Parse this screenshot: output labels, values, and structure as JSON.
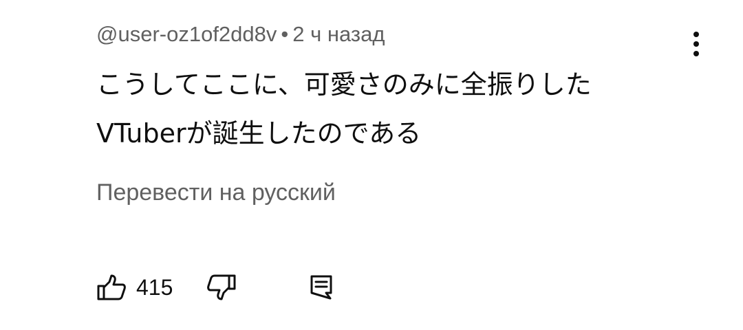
{
  "comment": {
    "author": "@user-oz1of2dd8v",
    "separator": "•",
    "time": "2 ч назад",
    "text": "こうしてここに、可愛さのみに全振りした\nVTuberが誕生したのである",
    "translate_label": "Перевести на русский",
    "like_count": "415",
    "icons": {
      "more": "more-vert-icon",
      "like": "thumb-up-icon",
      "dislike": "thumb-down-icon",
      "reply": "reply-comment-icon"
    }
  },
  "colors": {
    "text": "#0f0f0f",
    "secondary": "#606060",
    "background": "#ffffff"
  }
}
